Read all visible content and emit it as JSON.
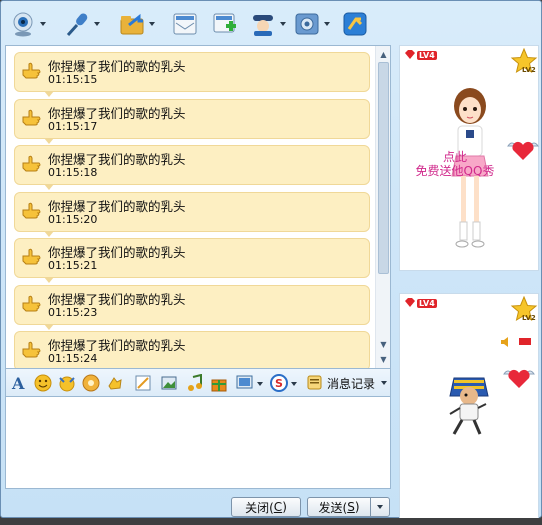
{
  "toolbar": {
    "items": [
      {
        "name": "webcam-icon",
        "has_menu": true
      },
      {
        "name": "microphone-icon",
        "has_menu": true
      },
      {
        "name": "send-file-icon",
        "has_menu": true
      },
      {
        "name": "email-icon",
        "has_menu": false
      },
      {
        "name": "create-group-icon",
        "has_menu": false
      },
      {
        "name": "remote-assist-icon",
        "has_menu": true
      },
      {
        "name": "app-settings-icon",
        "has_menu": true
      },
      {
        "name": "transfer-icon",
        "has_menu": false
      }
    ]
  },
  "messages": [
    {
      "text": "你捏爆了我们的歌的乳头",
      "time": "01:15:15"
    },
    {
      "text": "你捏爆了我们的歌的乳头",
      "time": "01:15:17"
    },
    {
      "text": "你捏爆了我们的歌的乳头",
      "time": "01:15:18"
    },
    {
      "text": "你捏爆了我们的歌的乳头",
      "time": "01:15:20"
    },
    {
      "text": "你捏爆了我们的歌的乳头",
      "time": "01:15:21"
    },
    {
      "text": "你捏爆了我们的歌的乳头",
      "time": "01:15:23"
    },
    {
      "text": "你捏爆了我们的歌的乳头",
      "time": "01:15:24"
    }
  ],
  "format_bar": {
    "message_record_label": "消息记录"
  },
  "buttons": {
    "close_label": "关闭(",
    "close_key": "C",
    "send_label": "发送(",
    "send_key": "S"
  },
  "right_panel": {
    "top": {
      "level_badge": "LV4",
      "star_badge": "LV2",
      "promo_line1": "点此",
      "promo_line2": "免费送他QQ秀"
    },
    "bottom": {
      "level_badge": "LV4",
      "star_badge": "LV2"
    }
  },
  "colors": {
    "bubble_bg": "#fdefc2",
    "window_bg": "#d9ecfa",
    "promo_text": "#d02a8c"
  }
}
